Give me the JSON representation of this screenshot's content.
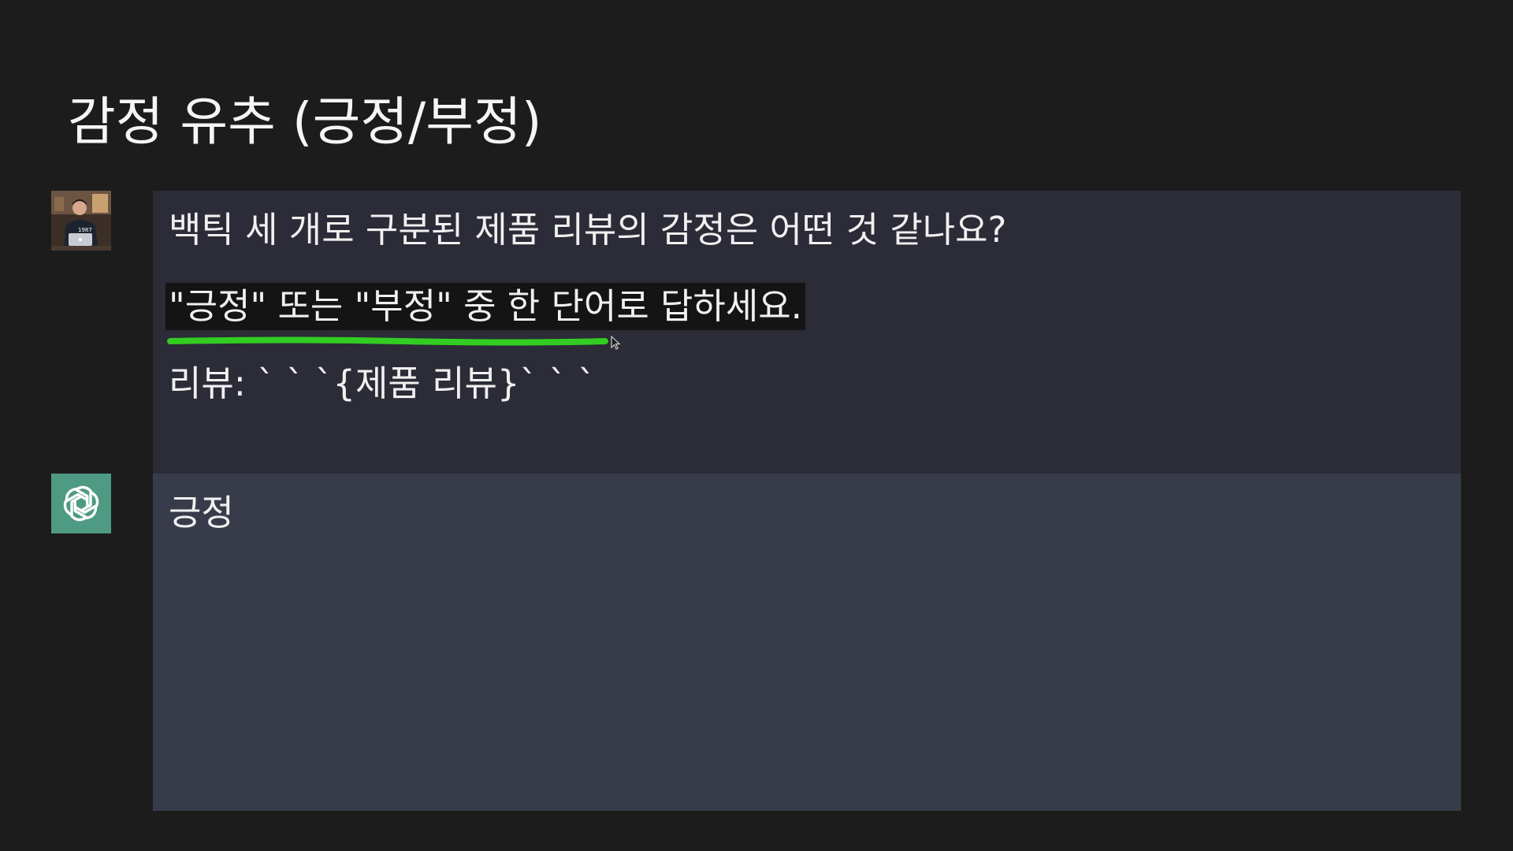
{
  "slide": {
    "title": "감정 유추 (긍정/부정)"
  },
  "conversation": {
    "user_message": {
      "line1": "백틱 세 개로 구분된 제품 리뷰의 감정은 어떤 것 같나요?",
      "line2": "\"긍정\" 또는 \"부정\" 중 한 단어로 답하세요.",
      "line3": "리뷰: ` ` `{제품 리뷰}` ` `"
    },
    "assistant_message": {
      "text": "긍정"
    }
  },
  "icons": {
    "user_avatar": "user-photo-avatar",
    "assistant_avatar": "chatgpt-logo-icon",
    "cursor": "mouse-pointer-icon"
  },
  "colors": {
    "background": "#1c1c1d",
    "user_panel": "#2b2c37",
    "assistant_panel": "#383c4a",
    "assistant_avatar_bg": "#4e9a82",
    "highlight_bg": "#141414",
    "annotation_underline": "#33cc22"
  }
}
